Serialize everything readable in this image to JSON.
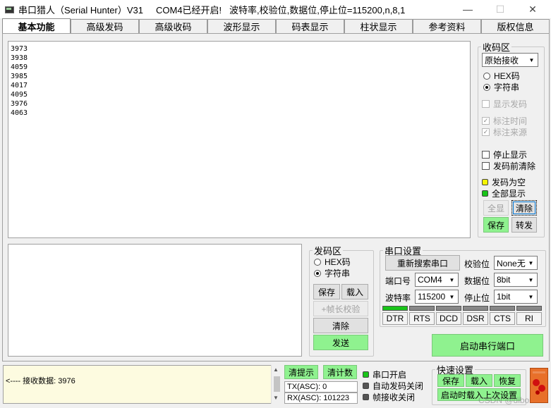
{
  "title": {
    "app_name": "串口猎人（Serial Hunter）V31",
    "status": "COM4已经开启!   波特率,校验位,数据位,停止位=115200,n,8,1",
    "minimize": "—",
    "maximize": "☐",
    "close": "✕"
  },
  "tabs": [
    "基本功能",
    "高级发码",
    "高级收码",
    "波形显示",
    "码表显示",
    "柱状显示",
    "参考资料",
    "版权信息"
  ],
  "receive_area": {
    "lines": [
      "3973",
      "3938",
      "4059",
      "3985",
      "4017",
      "4095",
      "3976",
      "4063"
    ]
  },
  "recv_panel": {
    "legend": "收码区",
    "mode_select": "原始接收",
    "radio_hex": "HEX码",
    "radio_str": "字符串",
    "chk_show_send": "显示发码",
    "chk_time": "标注时间",
    "chk_source": "标注来源",
    "chk_stop": "停止显示",
    "chk_clear_before": "发码前清除",
    "led_send_empty": "发码为空",
    "led_show_all": "全部显示",
    "btn_select_all": "全显",
    "btn_clear": "清除",
    "btn_save": "保存",
    "btn_forward": "转发",
    "lamp_yellow": "#f4f400",
    "lamp_green": "#19c419"
  },
  "send_panel": {
    "legend": "发码区",
    "radio_hex": "HEX码",
    "radio_str": "字符串",
    "btn_save": "保存",
    "btn_load": "载入",
    "btn_checksum": "+帧长校验",
    "btn_clear": "清除",
    "btn_send": "发送"
  },
  "serial_settings": {
    "legend": "串口设置",
    "btn_rescan": "重新搜索串口",
    "parity_label": "校验位",
    "parity_value": "None无",
    "port_label": "端口号",
    "port_value": "COM4",
    "databits_label": "数据位",
    "databits_value": "8bit",
    "baud_label": "波特率",
    "baud_value": "115200",
    "stopbits_label": "停止位",
    "stopbits_value": "1bit",
    "signals": [
      "DTR",
      "RTS",
      "DCD",
      "DSR",
      "CTS",
      "RI"
    ],
    "signals_on": [
      true,
      false,
      false,
      false,
      false,
      false
    ],
    "btn_start": "启动串行端口"
  },
  "status_bar": {
    "message": "<---- 接收数据:   3976",
    "btn_clear_tip": "清提示",
    "btn_clear_count": "清计数",
    "tx_label": "TX(ASC):",
    "tx_value": "0",
    "rx_label": "RX(ASC):",
    "rx_value": "101223",
    "led_port_open": "串口开启",
    "led_auto_send_off": "自动发码关闭",
    "led_frame_off": "帧接收关闭"
  },
  "quick_settings": {
    "legend": "快速设置",
    "btn_save": "保存",
    "btn_load": "载入",
    "btn_restore": "恢复",
    "btn_startup_load": "启动时载入上次设置"
  },
  "watermark": "CSDN @dibo"
}
